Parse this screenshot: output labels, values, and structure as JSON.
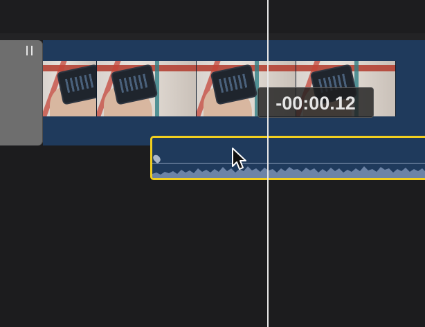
{
  "timeline": {
    "timecode": "-00:00.12",
    "accent_color": "#f2cf1f",
    "clip_color": "#1f3a5c",
    "playhead_color": "#e8e8e8"
  },
  "icons": {
    "cursor": "arrow-pointer-icon",
    "volume_handle": "volume-keyframe-icon"
  }
}
